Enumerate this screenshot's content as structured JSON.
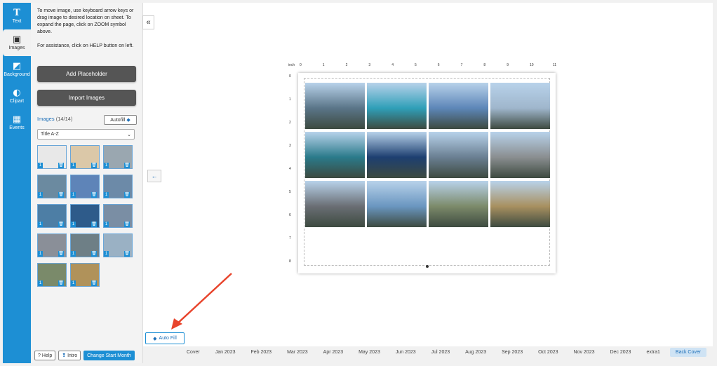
{
  "rail": {
    "items": [
      {
        "label": "Text",
        "glyph": "T",
        "icon": "text-icon"
      },
      {
        "label": "Images",
        "glyph": "▣",
        "icon": "image-icon",
        "active": true
      },
      {
        "label": "Background",
        "glyph": "◩",
        "icon": "background-icon"
      },
      {
        "label": "Clipart",
        "glyph": "◐",
        "icon": "clipart-icon"
      },
      {
        "label": "Events",
        "glyph": "▦",
        "icon": "calendar-icon"
      }
    ]
  },
  "panel": {
    "instructions": "To move image, use keyboard arrow keys or drag image to desired location on sheet. To expand the page, click on ZOOM symbol above.",
    "assistance": "For assistance, click on HELP button on left.",
    "add_placeholder": "Add Placeholder",
    "import_images": "Import Images",
    "images_label": "Images",
    "images_count": "(14/14)",
    "autofill_label": "Autofill",
    "sort_value": "Title A-Z",
    "thumbs": [
      {
        "color": "#e8e8e8",
        "num": "1",
        "trash": "🗑"
      },
      {
        "color": "#dbc8a8",
        "num": "1",
        "trash": "🗑"
      },
      {
        "color": "#9aa7b0",
        "num": "1",
        "trash": "🗑"
      },
      {
        "color": "#6b8aa0",
        "num": "1",
        "trash": "🗑"
      },
      {
        "color": "#5e84b8",
        "num": "1",
        "trash": "🗑"
      },
      {
        "color": "#6c8aa8",
        "num": "1",
        "trash": "🗑"
      },
      {
        "color": "#4d7ea5",
        "num": "1",
        "trash": "🗑"
      },
      {
        "color": "#2e5b8a",
        "num": "1",
        "trash": "🗑"
      },
      {
        "color": "#7a8ea4",
        "num": "1",
        "trash": "🗑"
      },
      {
        "color": "#8a8f98",
        "num": "1",
        "trash": "🗑"
      },
      {
        "color": "#6e7f86",
        "num": "1",
        "trash": "🗑"
      },
      {
        "color": "#9ab1c4",
        "num": "1",
        "trash": "🗑"
      },
      {
        "color": "#7a8a6a",
        "num": "1",
        "trash": "🗑"
      },
      {
        "color": "#b0925a",
        "num": "1",
        "trash": "🗑"
      }
    ],
    "help_label": "Help",
    "intro_label": "Intro",
    "change_start_label": "Change Start Month"
  },
  "canvas": {
    "ruler_unit": "inch",
    "ruler_top": [
      "0",
      "1",
      "2",
      "3",
      "4",
      "5",
      "6",
      "7",
      "8",
      "9",
      "10",
      "11"
    ],
    "ruler_left": [
      "0",
      "1",
      "2",
      "3",
      "4",
      "5",
      "6",
      "7",
      "8"
    ],
    "photos": [
      "#5a7588",
      "#2f9fb8",
      "#5d86b8",
      "#9fb6cc",
      "#2a7a8a",
      "#1d3f70",
      "#6a7f92",
      "#8a8e90",
      "#6a6e74",
      "#6a96c0",
      "#7c8a6a",
      "#a89060"
    ]
  },
  "autofill_bottom": "Auto Fill",
  "tabs": [
    "Cover",
    "Jan 2023",
    "Feb 2023",
    "Mar 2023",
    "Apr 2023",
    "May 2023",
    "Jun 2023",
    "Jul 2023",
    "Aug 2023",
    "Sep 2023",
    "Oct 2023",
    "Nov 2023",
    "Dec 2023",
    "extra1",
    "Back Cover"
  ],
  "active_tab": "Back Cover",
  "accent": "#1d8fd4"
}
